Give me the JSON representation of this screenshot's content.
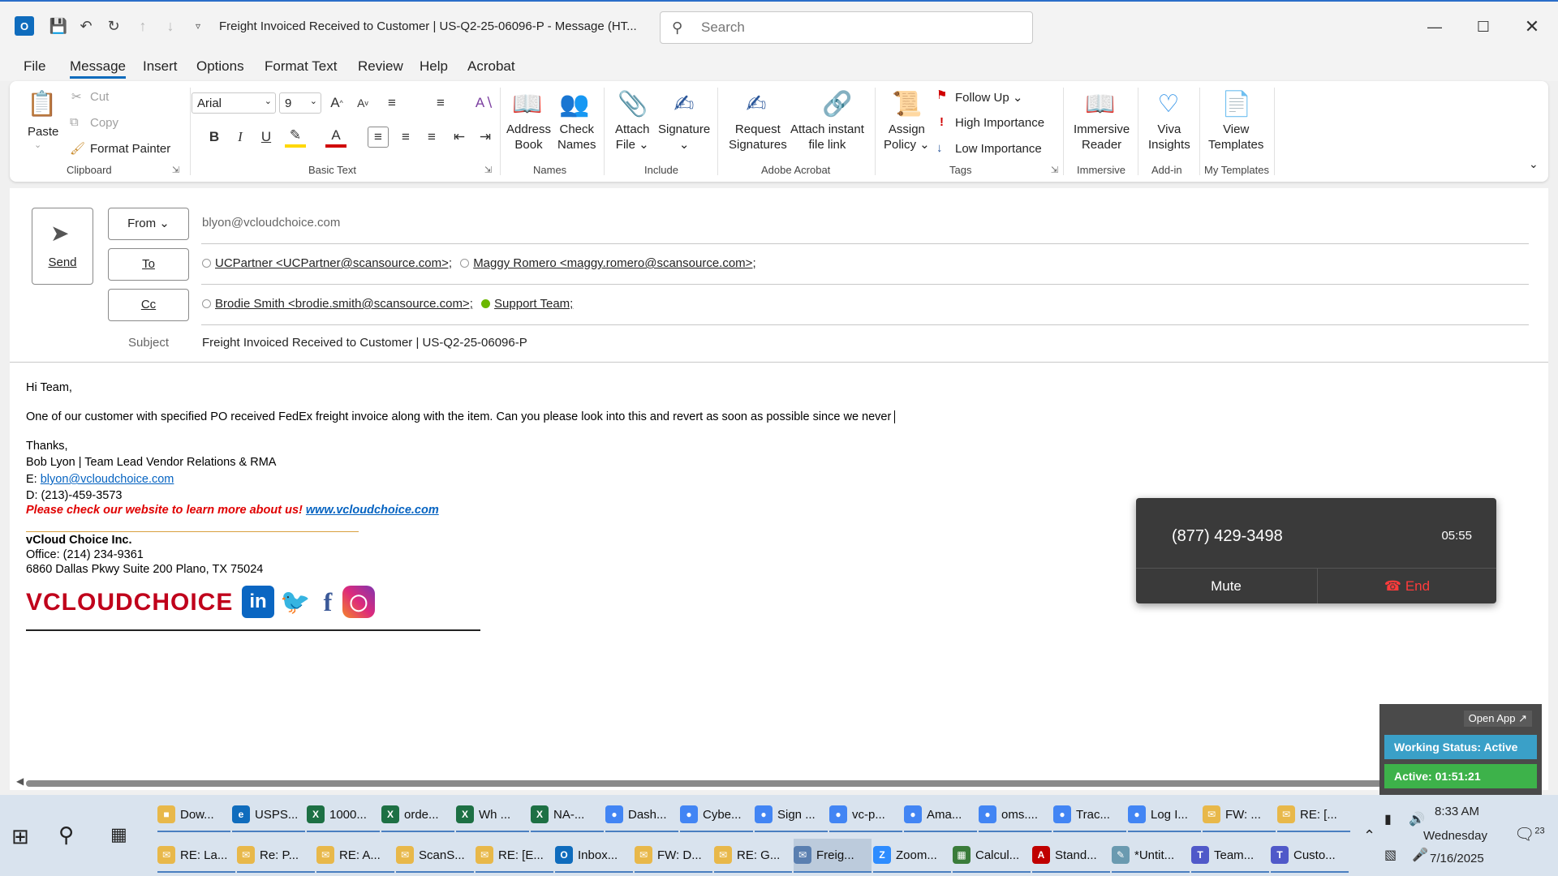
{
  "window": {
    "title": "Freight Invoiced Received to Customer | US-Q2-25-06096-P  -  Message (HT...",
    "search_placeholder": "Search"
  },
  "tabs": [
    "File",
    "Message",
    "Insert",
    "Options",
    "Format Text",
    "Review",
    "Help",
    "Acrobat"
  ],
  "ribbon": {
    "paste": "Paste",
    "cut": "Cut",
    "copy": "Copy",
    "format_painter": "Format Painter",
    "clipboard": "Clipboard",
    "font_name": "Arial",
    "font_size": "9",
    "basic_text": "Basic Text",
    "address_book": [
      "Address",
      "Book"
    ],
    "check_names": [
      "Check",
      "Names"
    ],
    "names": "Names",
    "attach_file": [
      "Attach",
      "File"
    ],
    "signature": "Signature",
    "include": "Include",
    "request_signatures": [
      "Request",
      "Signatures"
    ],
    "attach_instant": [
      "Attach instant",
      "file link"
    ],
    "adobe_acrobat": "Adobe Acrobat",
    "assign_policy": [
      "Assign",
      "Policy"
    ],
    "follow_up": "Follow Up",
    "high_importance": "High Importance",
    "low_importance": "Low Importance",
    "tags": "Tags",
    "immersive_reader": [
      "Immersive",
      "Reader"
    ],
    "immersive": "Immersive",
    "viva_insights": [
      "Viva",
      "Insights"
    ],
    "add_in": "Add-in",
    "view_templates": [
      "View",
      "Templates"
    ],
    "my_templates": "My Templates"
  },
  "compose": {
    "send": "Send",
    "from_label": "From",
    "from_value": "blyon@vcloudchoice.com",
    "to_label": "To",
    "to_recipients": [
      "UCPartner <UCPartner@scansource.com>;",
      "Maggy Romero <maggy.romero@scansource.com>;"
    ],
    "cc_label": "Cc",
    "cc_recipients": [
      "Brodie Smith <brodie.smith@scansource.com>;",
      "Support Team;"
    ],
    "subject_label": "Subject",
    "subject_value": "Freight Invoiced Received to Customer | US-Q2-25-06096-P"
  },
  "body": {
    "greeting": "Hi Team,",
    "message": "One of our customer with specified PO received FedEx freight invoice along with the item. Can you please look into this and revert as soon as possible since we never",
    "thanks": "Thanks,",
    "sig_name": "Bob Lyon | Team Lead Vendor Relations & RMA",
    "email_prefix": "E:",
    "email": "blyon@vcloudchoice.com",
    "phone": "D: (213)-459-3573",
    "promo": "Please check our website to learn more about us!",
    "website": "www.vcloudchoice.com",
    "company": "vCloud Choice Inc.",
    "office": "Office: (214) 234-9361",
    "address": "6860 Dallas Pkwy Suite 200 Plano, TX 75024",
    "logo_text": "VCLOUDCHOICE"
  },
  "call": {
    "number": "(877) 429-3498",
    "timer": "05:55",
    "mute": "Mute",
    "end": "End"
  },
  "status": {
    "open_app": "Open App ↗",
    "working": "Working Status: Active",
    "active": "Active: 01:51:21"
  },
  "taskbar": {
    "row1": [
      "Dow...",
      "USPS...",
      "1000...",
      "orde...",
      "Wh ...",
      "NA-...",
      "Dash...",
      "Cybe...",
      "Sign ...",
      "vc-p...",
      "Ama...",
      "oms....",
      "Trac...",
      "Log I...",
      "FW: ...",
      "RE: [..."
    ],
    "row2": [
      "RE: La...",
      "Re: P...",
      "RE: A...",
      "ScanS...",
      "RE: [E...",
      "Inbox...",
      "FW: D...",
      "RE: G...",
      "Freig...",
      "Zoom...",
      "Calcul...",
      "Stand...",
      "*Untit...",
      "Team...",
      "Custo..."
    ],
    "time": "8:33 AM",
    "day": "Wednesday",
    "date": "7/16/2025",
    "notifications": "23"
  },
  "colors": {
    "accent": "#0f6cbd",
    "end_call": "#ff3b3b",
    "working_status": "#3aa0c8",
    "active_status": "#3db24a"
  }
}
